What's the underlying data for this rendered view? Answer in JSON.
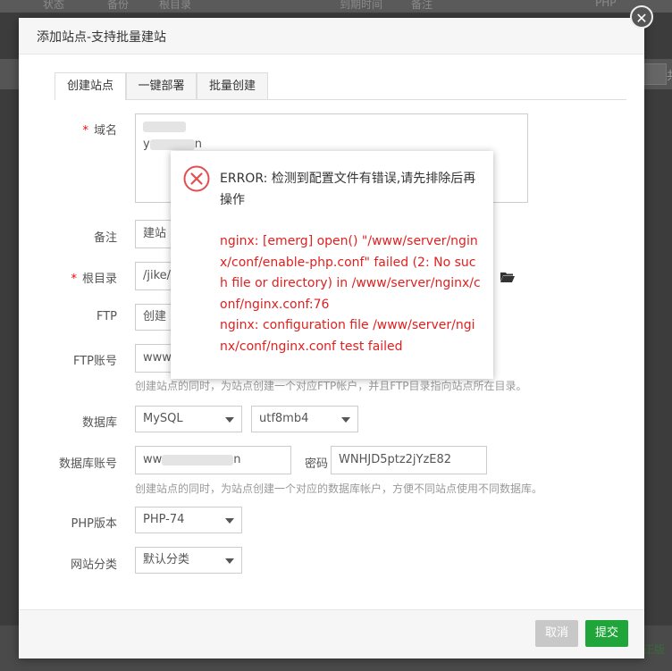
{
  "background": {
    "top_columns": [
      "状态",
      "备份",
      "根目录",
      "到期时间",
      "备注",
      "PHP"
    ],
    "strip_char": "共",
    "bottom_link": "正版"
  },
  "dialog": {
    "title": "添加站点-支持批量建站",
    "close_glyph": "✕"
  },
  "tabs": [
    "创建站点",
    "一键部署",
    "批量创建"
  ],
  "form": {
    "domain": {
      "label": "域名",
      "line1_prefix": "",
      "line2_prefix": "y",
      "line2_suffix": "n"
    },
    "remark": {
      "label": "备注",
      "value": "建站"
    },
    "root": {
      "label": "根目录",
      "value": "/jike/"
    },
    "ftp": {
      "label": "FTP",
      "value": "创建"
    },
    "ftp_account": {
      "label": "FTP账号",
      "value": "www",
      "hint": "创建站点的同时，为站点创建一个对应FTP帐户，并且FTP目录指向站点所在目录。"
    },
    "database": {
      "label": "数据库",
      "type": "MySQL",
      "charset": "utf8mb4"
    },
    "db_account": {
      "label": "数据库账号",
      "value_prefix": "ww",
      "value_suffix": "n",
      "password_label": "密码",
      "password": "WNHJD5ptz2jYzE82",
      "hint": "创建站点的同时，为站点创建一个对应的数据库帐户，方便不同站点使用不同数据库。"
    },
    "php": {
      "label": "PHP版本",
      "value": "PHP-74"
    },
    "category": {
      "label": "网站分类",
      "value": "默认分类"
    }
  },
  "footer": {
    "cancel": "取消",
    "submit": "提交"
  },
  "error": {
    "title": "ERROR: 检测到配置文件有错误,请先排除后再操作",
    "detail_line1": "nginx: [emerg] open() \"/www/server/nginx/conf/enable-php.conf\" failed (2: No such file or directory) in /www/server/nginx/conf/nginx.conf:76",
    "detail_line2": "nginx: configuration file /www/server/nginx/conf/nginx.conf test failed"
  },
  "colors": {
    "submit": "#20a53a",
    "error_text": "#e02020",
    "error_icon": "#e05050"
  }
}
